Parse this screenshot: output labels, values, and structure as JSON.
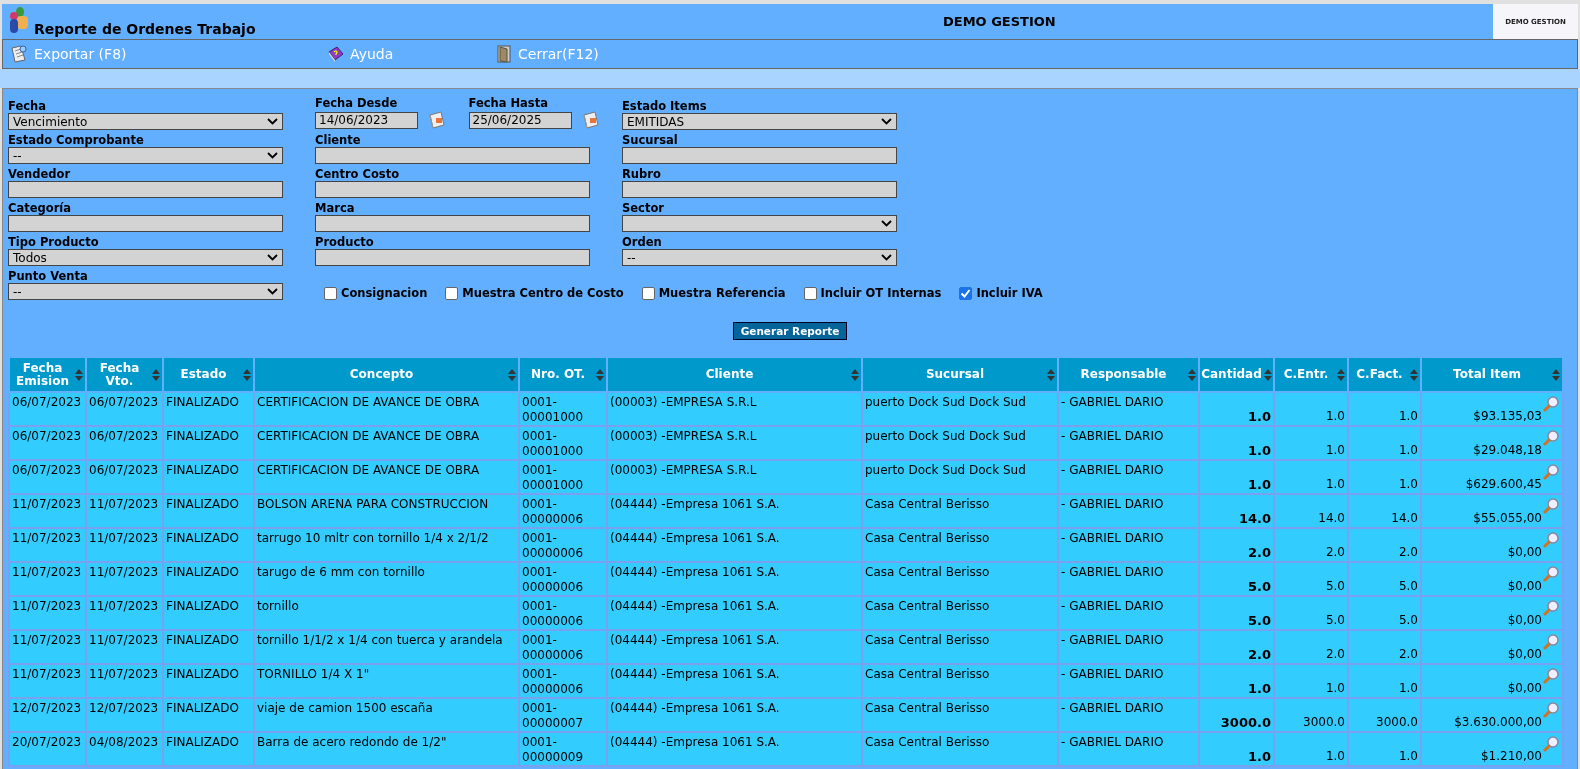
{
  "header": {
    "title": "Reporte de Ordenes Trabajo",
    "company": "DEMO GESTION",
    "brand_logo": "DEMO GESTION"
  },
  "toolbar": [
    {
      "kind": "export",
      "label": "Exportar (F8)"
    },
    {
      "kind": "help",
      "label": "Ayuda"
    },
    {
      "kind": "close",
      "label": "Cerrar(F12)"
    }
  ],
  "filters": [
    [
      {
        "kind": "select",
        "label": "Fecha",
        "value": "Vencimiento"
      },
      {
        "kind": "date",
        "label": "Fecha Desde",
        "value": "14/06/2023"
      },
      {
        "kind": "date",
        "label": "Fecha Hasta",
        "value": "25/06/2025"
      },
      {
        "kind": "select",
        "label": "Estado Items",
        "value": "EMITIDAS"
      }
    ],
    [
      {
        "kind": "select",
        "label": "Estado Comprobante",
        "value": "--"
      },
      {
        "kind": "text",
        "label": "Cliente"
      },
      {
        "kind": "text",
        "label": "Sucursal"
      }
    ],
    [
      {
        "kind": "text",
        "label": "Vendedor"
      },
      {
        "kind": "text",
        "label": "Centro Costo"
      },
      {
        "kind": "text",
        "label": "Rubro"
      }
    ],
    [
      {
        "kind": "text",
        "label": "Categoría"
      },
      {
        "kind": "text",
        "label": "Marca"
      },
      {
        "kind": "select",
        "label": "Sector"
      }
    ],
    [
      {
        "kind": "select",
        "label": "Tipo Producto",
        "value": "Todos"
      },
      {
        "kind": "text",
        "label": "Producto"
      },
      {
        "kind": "select",
        "label": "Orden",
        "value": "--"
      }
    ],
    [
      {
        "kind": "select",
        "label": "Punto Venta",
        "value": "--"
      }
    ]
  ],
  "options": [
    {
      "label": "Consignacion",
      "checked": false
    },
    {
      "label": "Muestra Centro de Costo",
      "checked": false
    },
    {
      "label": "Muestra Referencia",
      "checked": false
    },
    {
      "label": "Incluir OT Internas",
      "checked": false
    },
    {
      "label": "Incluir IVA",
      "checked": true
    }
  ],
  "generate_button": "Generar Reporte",
  "table": {
    "columns": [
      {
        "label": "Fecha Emision",
        "kind": "text"
      },
      {
        "label": "Fecha Vto.",
        "kind": "text"
      },
      {
        "label": "Estado",
        "kind": "text"
      },
      {
        "label": "Concepto",
        "kind": "text"
      },
      {
        "label": "Nro. OT.",
        "kind": "text"
      },
      {
        "label": "Cliente",
        "kind": "text"
      },
      {
        "label": "Sucursal",
        "kind": "text"
      },
      {
        "label": "Responsable",
        "kind": "text"
      },
      {
        "label": "Cantidad",
        "kind": "number"
      },
      {
        "label": "C.Entr.",
        "kind": "number"
      },
      {
        "label": "C.Fact.",
        "kind": "number"
      },
      {
        "label": "Total Item",
        "kind": "number"
      }
    ],
    "rows": [
      [
        "06/07/2023",
        "06/07/2023",
        "FINALIZADO",
        "CERTIFICACION DE AVANCE DE OBRA",
        "0001-00001000",
        "(00003) -EMPRESA S.R.L",
        "puerto Dock Sud Dock Sud",
        "- GABRIEL DARIO",
        "1.0",
        "1.0",
        "1.0",
        "$93.135,03"
      ],
      [
        "06/07/2023",
        "06/07/2023",
        "FINALIZADO",
        "CERTIFICACION DE AVANCE DE OBRA",
        "0001-00001000",
        "(00003) -EMPRESA S.R.L",
        "puerto Dock Sud Dock Sud",
        "- GABRIEL DARIO",
        "1.0",
        "1.0",
        "1.0",
        "$29.048,18"
      ],
      [
        "06/07/2023",
        "06/07/2023",
        "FINALIZADO",
        "CERTIFICACION DE AVANCE DE OBRA",
        "0001-00001000",
        "(00003) -EMPRESA S.R.L",
        "puerto Dock Sud Dock Sud",
        "- GABRIEL DARIO",
        "1.0",
        "1.0",
        "1.0",
        "$629.600,45"
      ],
      [
        "11/07/2023",
        "11/07/2023",
        "FINALIZADO",
        "BOLSON ARENA PARA CONSTRUCCION",
        "0001-00000006",
        "(04444) -Empresa 1061 S.A.",
        "Casa Central Berisso",
        "- GABRIEL DARIO",
        "14.0",
        "14.0",
        "14.0",
        "$55.055,00"
      ],
      [
        "11/07/2023",
        "11/07/2023",
        "FINALIZADO",
        "tarrugo 10 mltr con tornillo 1/4 x 2/1/2",
        "0001-00000006",
        "(04444) -Empresa 1061 S.A.",
        "Casa Central Berisso",
        "- GABRIEL DARIO",
        "2.0",
        "2.0",
        "2.0",
        "$0,00"
      ],
      [
        "11/07/2023",
        "11/07/2023",
        "FINALIZADO",
        "tarugo de 6 mm con tornillo",
        "0001-00000006",
        "(04444) -Empresa 1061 S.A.",
        "Casa Central Berisso",
        "- GABRIEL DARIO",
        "5.0",
        "5.0",
        "5.0",
        "$0,00"
      ],
      [
        "11/07/2023",
        "11/07/2023",
        "FINALIZADO",
        "tornillo",
        "0001-00000006",
        "(04444) -Empresa 1061 S.A.",
        "Casa Central Berisso",
        "- GABRIEL DARIO",
        "5.0",
        "5.0",
        "5.0",
        "$0,00"
      ],
      [
        "11/07/2023",
        "11/07/2023",
        "FINALIZADO",
        "tornillo 1/1/2 x 1/4 con tuerca y arandela",
        "0001-00000006",
        "(04444) -Empresa 1061 S.A.",
        "Casa Central Berisso",
        "- GABRIEL DARIO",
        "2.0",
        "2.0",
        "2.0",
        "$0,00"
      ],
      [
        "11/07/2023",
        "11/07/2023",
        "FINALIZADO",
        "TORNILLO 1/4 X 1\"",
        "0001-00000006",
        "(04444) -Empresa 1061 S.A.",
        "Casa Central Berisso",
        "- GABRIEL DARIO",
        "1.0",
        "1.0",
        "1.0",
        "$0,00"
      ],
      [
        "12/07/2023",
        "12/07/2023",
        "FINALIZADO",
        "viaje de camion 1500 escaña",
        "0001-00000007",
        "(04444) -Empresa 1061 S.A.",
        "Casa Central Berisso",
        "- GABRIEL DARIO",
        "3000.0",
        "3000.0",
        "3000.0",
        "$3.630.000,00"
      ],
      [
        "20/07/2023",
        "04/08/2023",
        "FINALIZADO",
        "Barra de acero redondo de 1/2\"",
        "0001-00000009",
        "(04444) -Empresa 1061 S.A.",
        "Casa Central Berisso",
        "- GABRIEL DARIO",
        "1.0",
        "1.0",
        "1.0",
        "$1.210,00"
      ]
    ]
  }
}
